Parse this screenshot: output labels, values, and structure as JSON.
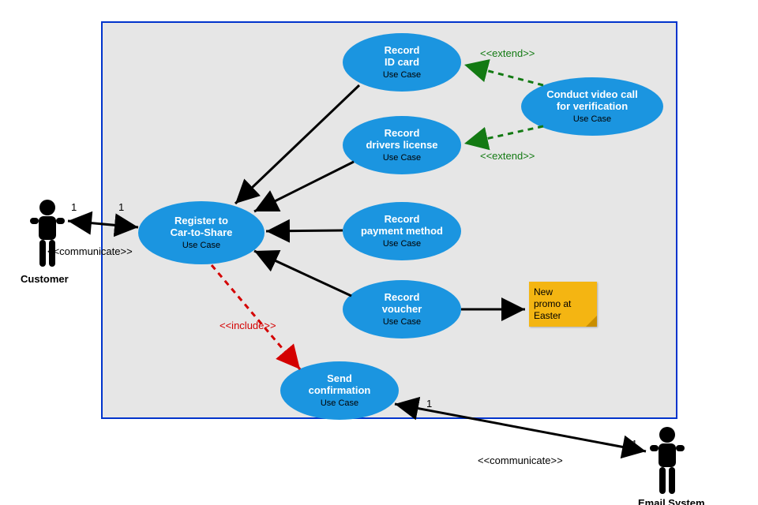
{
  "actors": {
    "customer": {
      "label": "Customer",
      "mult_near": "1",
      "mult_far": "1",
      "stereo": "<<communicate>>"
    },
    "email": {
      "label": "Email System",
      "mult_near": "1",
      "mult_far": "1",
      "stereo": "<<communicate>>"
    }
  },
  "usecases": {
    "register": {
      "title": "Register to\nCar-to-Share",
      "sub": "Use Case"
    },
    "record_id": {
      "title": "Record\nID card",
      "sub": "Use Case"
    },
    "record_dl": {
      "title": "Record\ndrivers license",
      "sub": "Use Case"
    },
    "record_pay": {
      "title": "Record\npayment method",
      "sub": "Use Case"
    },
    "record_voucher": {
      "title": "Record\nvoucher",
      "sub": "Use Case"
    },
    "video_call": {
      "title": "Conduct video call\nfor verification",
      "sub": "Use Case"
    },
    "send_conf": {
      "title": "Send\nconfirmation",
      "sub": "Use Case"
    }
  },
  "labels": {
    "extend1": "<<extend>>",
    "extend2": "<<extend>>",
    "include": "<<include>>"
  },
  "note": {
    "text": "New\npromo at\nEaster"
  }
}
